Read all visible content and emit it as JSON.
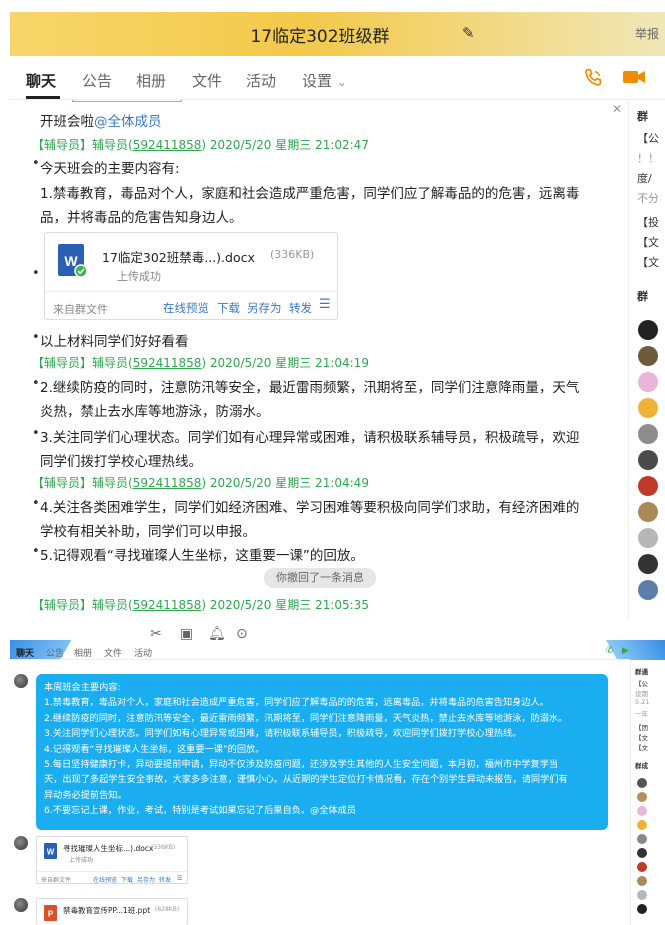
{
  "top": {
    "title": "17临定302班级群",
    "report": "举报",
    "tabs": [
      "聊天",
      "公告",
      "相册",
      "文件",
      "活动",
      "设置"
    ],
    "settings_arrow": "⌄",
    "messages": {
      "first_line": "开班会啦",
      "first_mention": "@全体成员",
      "m1_sender": "【辅导员】辅导员(",
      "m1_qq": "592411858",
      "m1_time": ") 2020/5/20 星期三 21:02:47",
      "m1_l1": "今天班会的主要内容有:",
      "m1_l2": "1.禁毒教育，毒品对个人，家庭和社会造成严重危害，同学们应了解毒品的的危害，远离毒",
      "m1_l3": "品，并将毒品的危害告知身边人。",
      "m1_after": "以上材料同学们好好看看",
      "m2_sender": "【辅导员】辅导员(",
      "m2_qq": "592411858",
      "m2_time": ") 2020/5/20 星期三 21:04:19",
      "m2_l1": "2.继续防疫的同时，注意防汛等安全，最近雷雨频繁，汛期将至，同学们注意降雨量，天气",
      "m2_l2": "炎热，禁止去水库等地游泳，防溺水。",
      "m2_l3": "3.关注同学们心理状态。同学们如有心理异常或困难，请积极联系辅导员，积极疏导，欢迎",
      "m2_l4": "同学们拨打学校心理热线。",
      "m3_sender": "【辅导员】辅导员(",
      "m3_qq": "592411858",
      "m3_time": ") 2020/5/20 星期三 21:04:49",
      "m3_l1": "4.关注各类困难学生，同学们如经济困难、学习困难等要积极向同学们求助，有经济困难的",
      "m3_l2": "学校有相关补助，同学们可以申报。",
      "m3_l3": "5.记得观看“寻找璀璨人生坐标，这重要一课”的回放。",
      "recall": "你撤回了一条消息",
      "m4_sender": "【辅导员】辅导员(",
      "m4_qq": "592411858",
      "m4_time": ") 2020/5/20 星期三 21:05:35"
    },
    "file": {
      "name": "17临定302班禁毒...).docx",
      "size": "(336KB)",
      "status": "上传成功",
      "source": "来自群文件",
      "actions": [
        "在线预览",
        "下载",
        "另存为",
        "转发"
      ]
    },
    "right_panel": [
      "群",
      "【公",
      "！！",
      "度/",
      "不分",
      "【投",
      "【文",
      "【文",
      "群"
    ]
  },
  "bottom": {
    "tabs": [
      "聊天",
      "公告",
      "相册",
      "文件",
      "活动"
    ],
    "bubble_lines": [
      "本周班会主要内容:",
      "1.禁毒教育，毒品对个人，家庭和社会造成严重危害，同学们应了解毒品的的危害，远离毒品，并将毒品的危害告知身边人。",
      "2.继续防疫的同时，注意防汛等安全，最近雷雨频繁，汛期将至，同学们注意降雨量，天气炎热，禁止去水库等地游泳，防溺水。",
      "3.关注同学们心理状态。同学们如有心理异常或困难，请积极联系辅导员，积极疏导，欢迎同学们拨打学校心理热线。",
      "4.记得观看“寻找璀璨人生坐标，这重要一课”的回放。",
      "5.每日坚持健康打卡，异动要提前申请，异动不仅涉及防疫问题，还涉及学生其他的人生安全问题，本月初，福州市中学复学当",
      "天，出现了多起学生安全事故，大家多多注意，谨慎小心。从近期的学生定位打卡情况看，存在个别学生异动未报告，请同学们有",
      "异动务必提前告知。",
      "6.不要忘记上课，作业，考试，特别是考试如果忘记了后果自负。@全体成员"
    ],
    "file1": {
      "name": "寻找璀璨人生坐标...).docx",
      "size": "(336KB)",
      "status": "上传成功",
      "source": "来自群文件",
      "actions": [
        "在线预览",
        "下载",
        "另存为",
        "转发"
      ]
    },
    "file2": {
      "name": "禁毒教育宣传PP...1班.ppt",
      "size": "(628KB)"
    },
    "right_panel": [
      "群通",
      "【公",
      "设期",
      "5.21",
      "一年",
      "【团",
      "【文",
      "【文",
      "群成"
    ]
  },
  "colors": {
    "accent_green": "#2fa84f",
    "link_blue": "#3a79c6",
    "bubble_blue": "#1aaef0",
    "title_gold": "#f3c94a",
    "icon_orange": "#f08c00"
  }
}
